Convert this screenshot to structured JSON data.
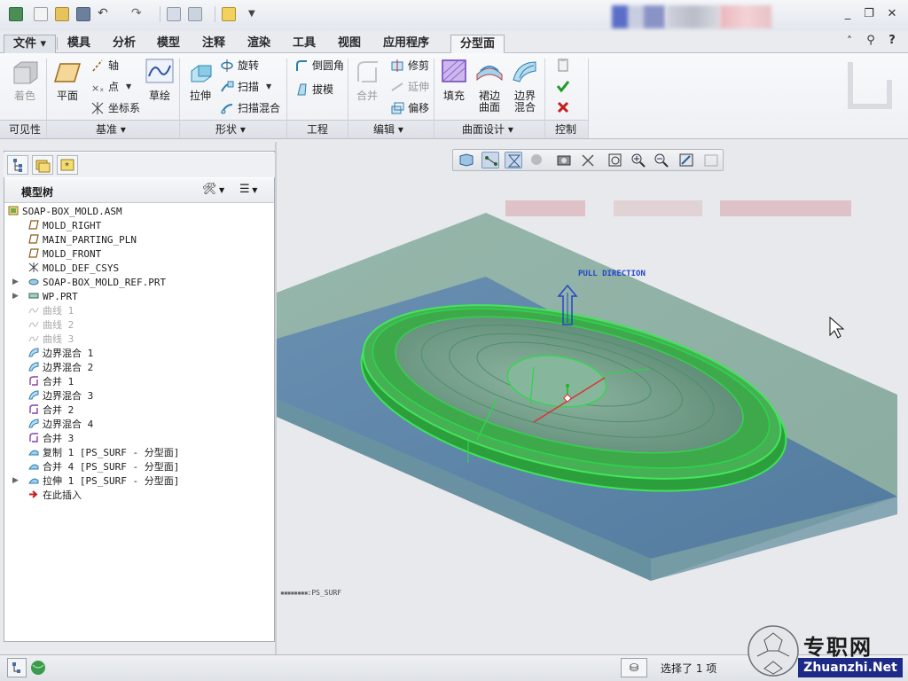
{
  "menu": {
    "file": "文件",
    "tabs": [
      "模具",
      "分析",
      "模型",
      "注释",
      "渲染",
      "工具",
      "视图",
      "应用程序"
    ],
    "active_tab": "分型面"
  },
  "ribbon": {
    "visibility": {
      "shade": "着色",
      "group": "可见性"
    },
    "datum": {
      "plane": "平面",
      "axis": "轴",
      "point": "点",
      "csys": "坐标系",
      "sketch": "草绘",
      "group": "基准"
    },
    "shapes": {
      "extrude": "拉伸",
      "revolve": "旋转",
      "sweep": "扫描",
      "swept_blend": "扫描混合",
      "group": "形状"
    },
    "engineering": {
      "round": "倒圆角",
      "draft": "拔模",
      "group": "工程"
    },
    "editing": {
      "merge": "合并",
      "trim": "修剪",
      "extend": "延伸",
      "offset": "偏移",
      "group": "编辑"
    },
    "surfaces": {
      "fill": "填充",
      "skirt_1": "裙边",
      "skirt_2": "曲面",
      "blend_1": "边界",
      "blend_2": "混合",
      "group": "曲面设计"
    },
    "control": {
      "group": "控制"
    }
  },
  "model_tree": {
    "title": "模型树",
    "items": [
      {
        "label": "SOAP-BOX_MOLD.ASM",
        "icon": "assembly-icon",
        "indent": 0,
        "expand": false,
        "gray": false
      },
      {
        "label": "MOLD_RIGHT",
        "icon": "datum-plane-icon",
        "indent": 1,
        "expand": false,
        "gray": false
      },
      {
        "label": "MAIN_PARTING_PLN",
        "icon": "datum-plane-icon",
        "indent": 1,
        "expand": false,
        "gray": false
      },
      {
        "label": "MOLD_FRONT",
        "icon": "datum-plane-icon",
        "indent": 1,
        "expand": false,
        "gray": false
      },
      {
        "label": "MOLD_DEF_CSYS",
        "icon": "csys-icon",
        "indent": 1,
        "expand": false,
        "gray": false
      },
      {
        "label": "SOAP-BOX_MOLD_REF.PRT",
        "icon": "ref-part-icon",
        "indent": 1,
        "expand": true,
        "gray": false
      },
      {
        "label": "WP.PRT",
        "icon": "workpiece-icon",
        "indent": 1,
        "expand": true,
        "gray": false
      },
      {
        "label": "曲线 1",
        "icon": "curve-icon",
        "indent": 1,
        "expand": false,
        "gray": true
      },
      {
        "label": "曲线 2",
        "icon": "curve-icon",
        "indent": 1,
        "expand": false,
        "gray": true
      },
      {
        "label": "曲线 3",
        "icon": "curve-icon",
        "indent": 1,
        "expand": false,
        "gray": true
      },
      {
        "label": "边界混合 1",
        "icon": "boundary-blend-icon",
        "indent": 1,
        "expand": false,
        "gray": false
      },
      {
        "label": "边界混合 2",
        "icon": "boundary-blend-icon",
        "indent": 1,
        "expand": false,
        "gray": false
      },
      {
        "label": "合并 1",
        "icon": "merge-icon",
        "indent": 1,
        "expand": false,
        "gray": false
      },
      {
        "label": "边界混合 3",
        "icon": "boundary-blend-icon",
        "indent": 1,
        "expand": false,
        "gray": false
      },
      {
        "label": "合并 2",
        "icon": "merge-icon",
        "indent": 1,
        "expand": false,
        "gray": false
      },
      {
        "label": "边界混合 4",
        "icon": "boundary-blend-icon",
        "indent": 1,
        "expand": false,
        "gray": false
      },
      {
        "label": "合并 3",
        "icon": "merge-icon",
        "indent": 1,
        "expand": false,
        "gray": false
      },
      {
        "label": "复制 1 [PS_SURF - 分型面]",
        "icon": "surface-icon",
        "indent": 1,
        "expand": false,
        "gray": false
      },
      {
        "label": "合并 4 [PS_SURF - 分型面]",
        "icon": "surface-icon",
        "indent": 1,
        "expand": false,
        "gray": false
      },
      {
        "label": "拉伸 1 [PS_SURF - 分型面]",
        "icon": "surface-icon",
        "indent": 1,
        "expand": true,
        "gray": false
      },
      {
        "label": "在此插入",
        "icon": "insert-arrow-icon",
        "indent": 1,
        "expand": false,
        "gray": false
      }
    ]
  },
  "viewport": {
    "pull_direction": "PULL DIRECTION",
    "surface_tag": "PS_SURF"
  },
  "status": {
    "selected": "选择了 1 项"
  },
  "watermark": {
    "brand_cn": "专职网",
    "brand_url": "Zhuanzhi.Net"
  },
  "colors": {
    "accent_green": "#21a53a",
    "workpiece": "#8aa99c",
    "parting_plane": "#3f6fa8",
    "tree_selection": "#3366cc"
  }
}
